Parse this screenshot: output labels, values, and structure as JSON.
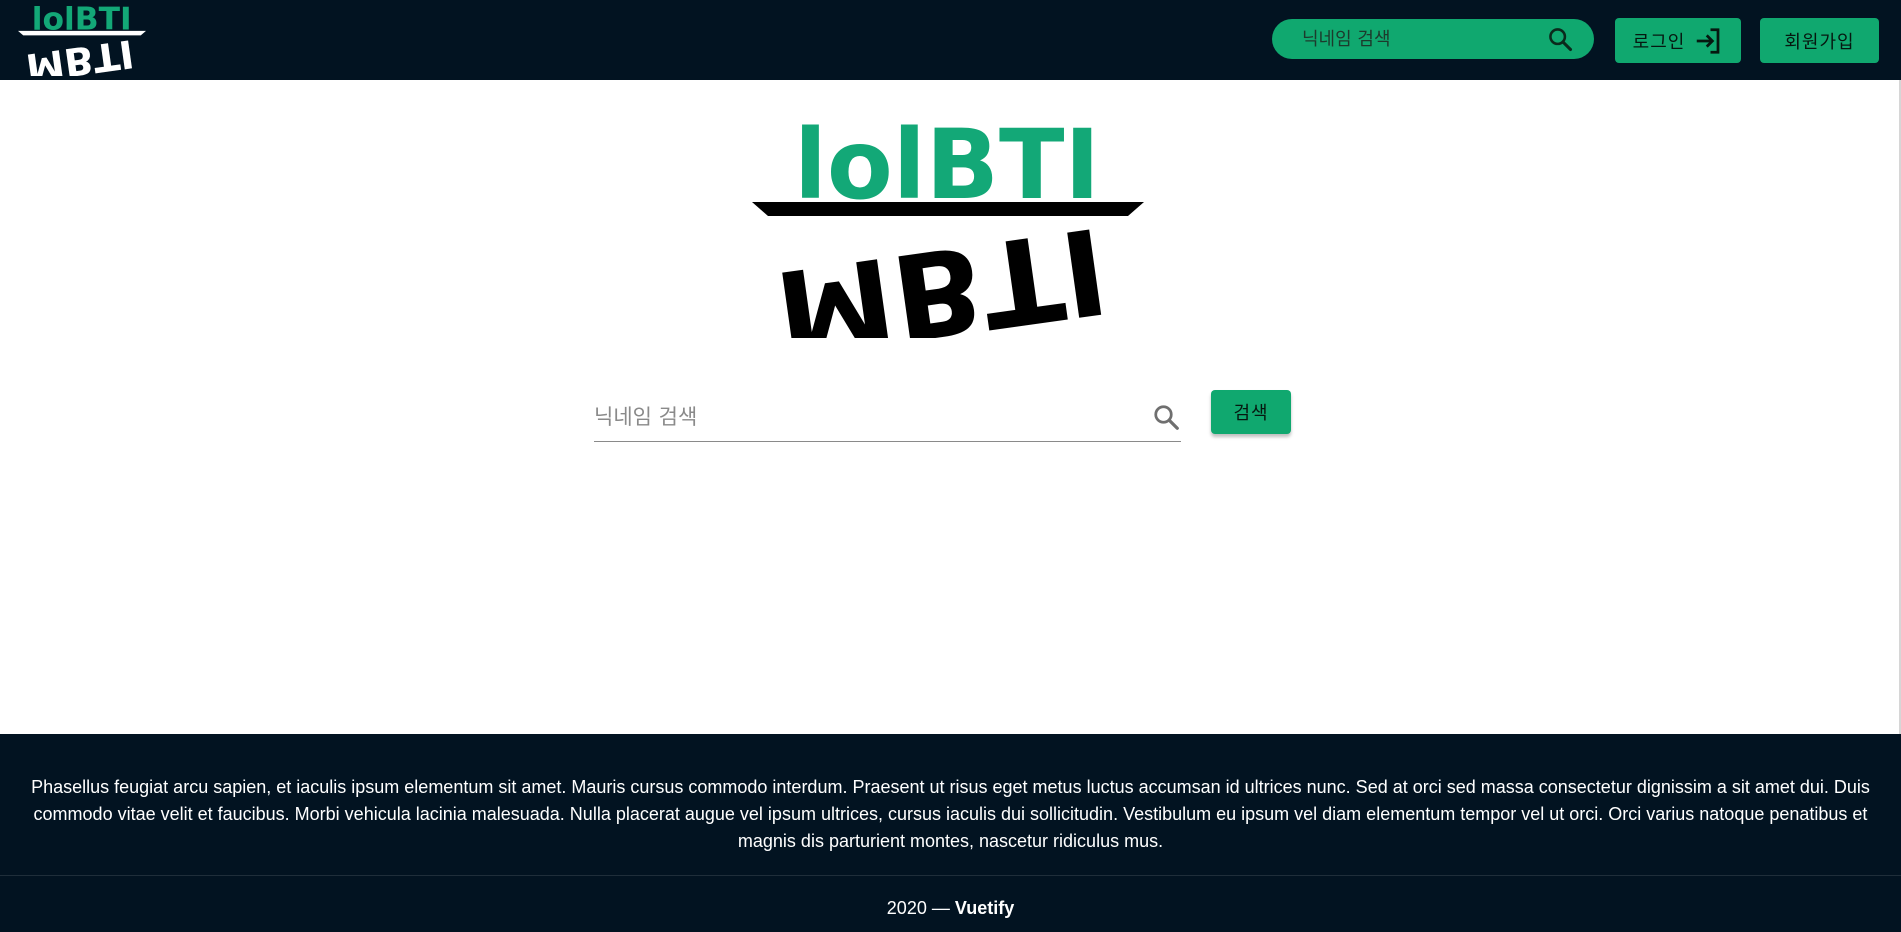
{
  "header": {
    "logo_top": "lolBTI",
    "logo_bottom": "MBTI",
    "search_placeholder": "닉네임 검색",
    "login_label": "로그인",
    "signup_label": "회원가입"
  },
  "main": {
    "logo_top": "lolBTI",
    "logo_bottom": "MBTI",
    "search_placeholder": "닉네임 검색",
    "search_button_label": "검색"
  },
  "footer": {
    "text": "Phasellus feugiat arcu sapien, et iaculis ipsum elementum sit amet. Mauris cursus commodo interdum. Praesent ut risus eget metus luctus accumsan id ultrices nunc. Sed at orci sed massa consectetur dignissim a sit amet dui. Duis commodo vitae velit et faucibus. Morbi vehicula lacinia malesuada. Nulla placerat augue vel ipsum ultrices, cursus iaculis dui sollicitudin. Vestibulum eu ipsum vel diam elementum tempor vel ut orci. Orci varius natoque penatibus et magnis dis parturient montes, nascetur ridiculus mus.",
    "year": "2020 —",
    "brand": "Vuetify"
  },
  "colors": {
    "navy": "#021321",
    "accent_green": "#10a86f",
    "logo_green": "#13a877"
  },
  "icons": {
    "search": "search-icon",
    "login": "login-arrow-icon"
  }
}
